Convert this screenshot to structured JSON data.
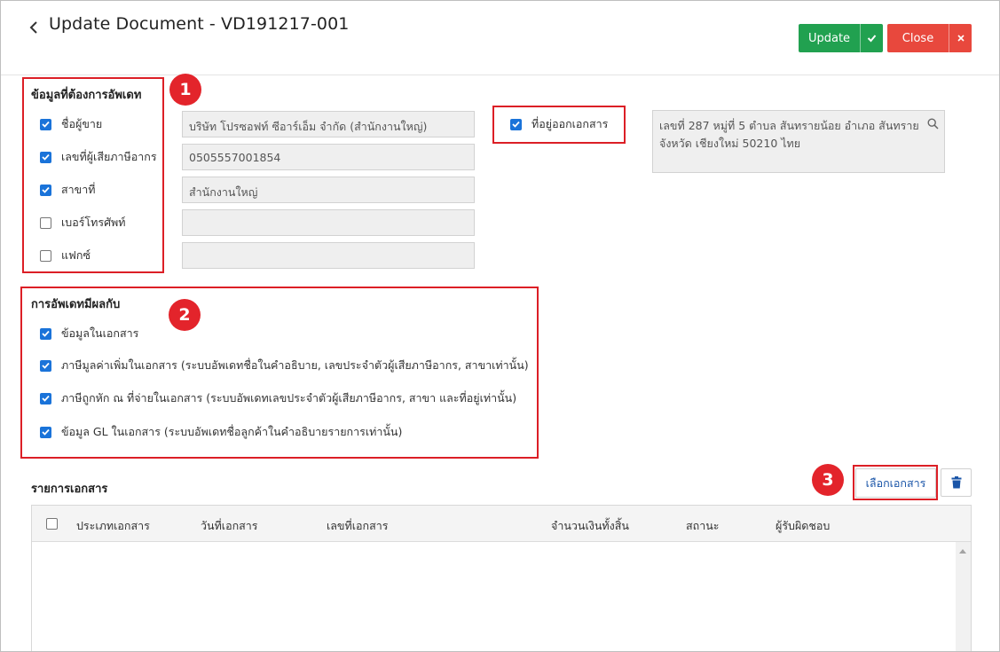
{
  "header": {
    "title": "Update Document - VD191217-001",
    "update_label": "Update",
    "close_label": "Close"
  },
  "section1": {
    "title": "ข้อมูลที่ต้องการอัพเดท",
    "badge": "1",
    "items": [
      {
        "label": "ชื่อผู้ขาย",
        "checked": true,
        "value": "บริษัท โปรซอฟท์ ซีอาร์เอ็ม จำกัด (สำนักงานใหญ่)"
      },
      {
        "label": "เลขที่ผู้เสียภาษีอากร",
        "checked": true,
        "value": "0505557001854"
      },
      {
        "label": "สาขาที่",
        "checked": true,
        "value": "สำนักงานใหญ่"
      },
      {
        "label": "เบอร์โทรศัพท์",
        "checked": false,
        "value": ""
      },
      {
        "label": "แฟกซ์",
        "checked": false,
        "value": ""
      }
    ],
    "address_label": "ที่อยู่ออกเอกสาร",
    "address_checked": true,
    "address_value": "เลขที่ 287 หมู่ที่ 5 ตำบล สันทรายน้อย อำเภอ สันทราย จังหวัด เชียงใหม่ 50210 ไทย"
  },
  "section2": {
    "title": "การอัพเดทมีผลกับ",
    "badge": "2",
    "items": [
      {
        "label": "ข้อมูลในเอกสาร",
        "checked": true
      },
      {
        "label": "ภาษีมูลค่าเพิ่มในเอกสาร  (ระบบอัพเดทชื่อในคำอธิบาย, เลขประจำตัวผู้เสียภาษีอากร, สาขาเท่านั้น)",
        "checked": true
      },
      {
        "label": "ภาษีถูกหัก ณ ที่จ่ายในเอกสาร  (ระบบอัพเดทเลขประจำตัวผู้เสียภาษีอากร, สาขา และที่อยู่เท่านั้น)",
        "checked": true
      },
      {
        "label": "ข้อมูล GL ในเอกสาร  (ระบบอัพเดทชื่อลูกค้าในคำอธิบายรายการเท่านั้น)",
        "checked": true
      }
    ]
  },
  "document_list": {
    "title": "รายการเอกสาร",
    "badge": "3",
    "select_button_label": "เลือกเอกสาร",
    "columns": [
      "ประเภทเอกสาร",
      "วันที่เอกสาร",
      "เลขที่เอกสาร",
      "จำนวนเงินทั้งสิ้น",
      "สถานะ",
      "ผู้รับผิดชอบ"
    ],
    "rows": []
  },
  "colors": {
    "update_green": "#21a150",
    "close_red": "#e8483d",
    "annotation_red": "#dc1f26",
    "checkbox_blue": "#1a73d9",
    "link_blue": "#1a55a8"
  },
  "icons": {
    "back": "chevron-left-icon",
    "update": "check-icon",
    "close": "x-icon",
    "address_search": "search-icon",
    "delete": "trash-icon"
  }
}
